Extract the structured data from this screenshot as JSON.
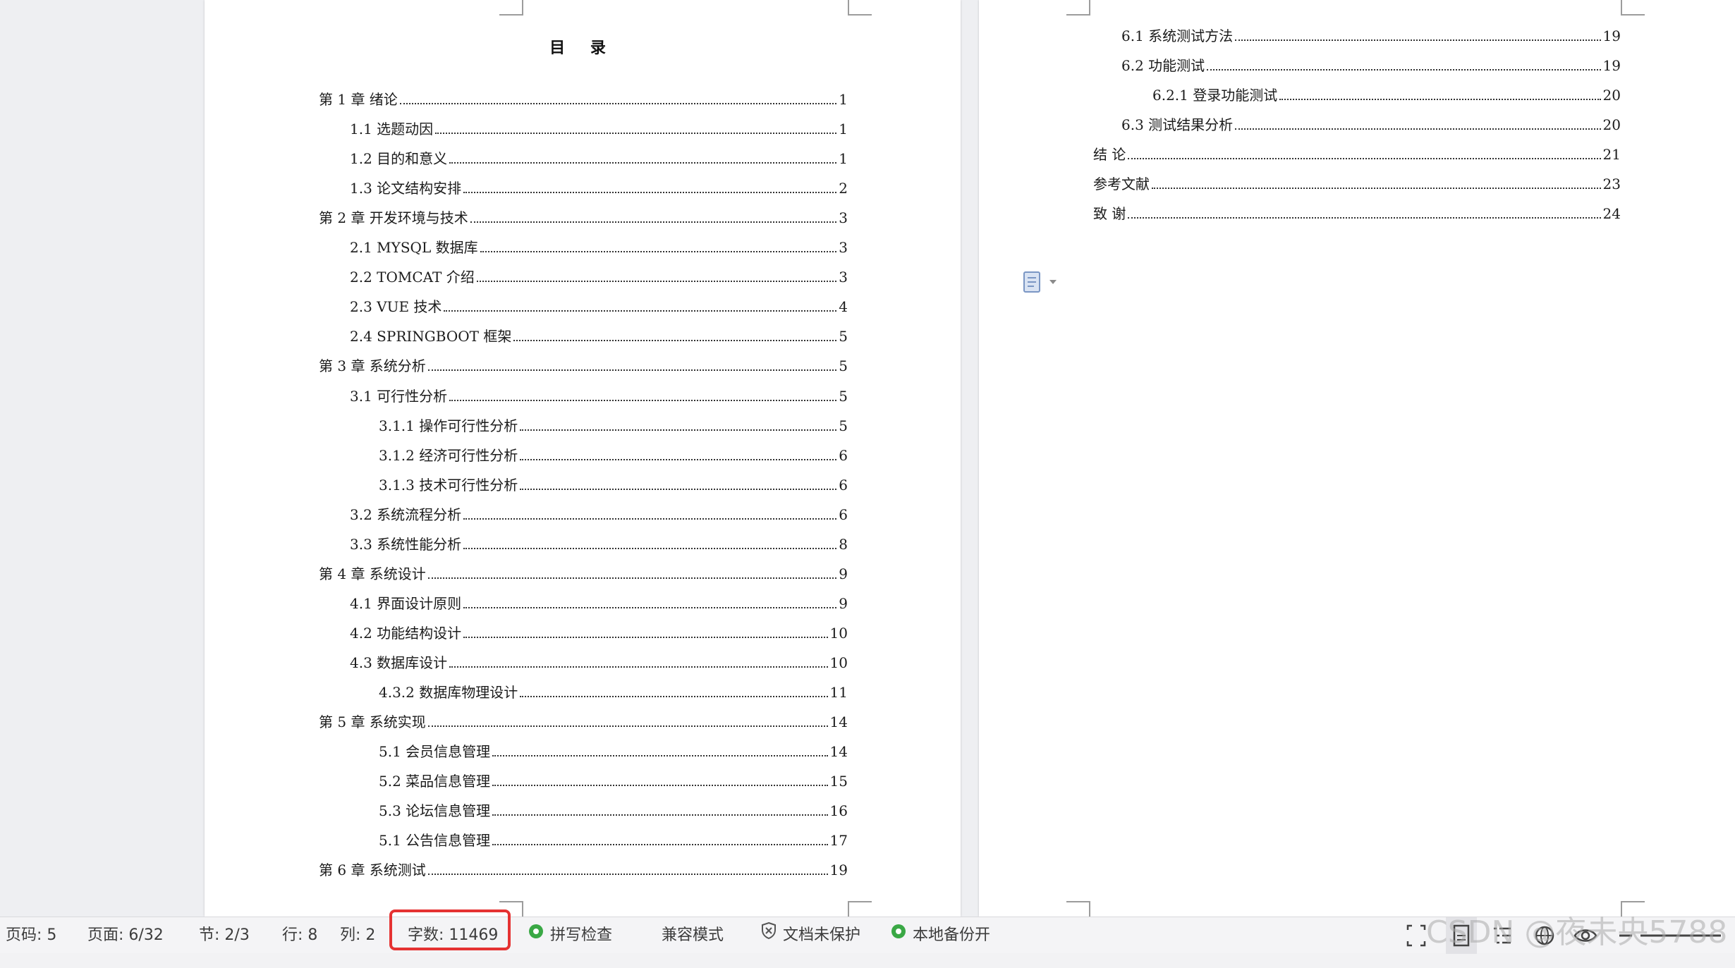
{
  "toc": {
    "title": "目 录",
    "left_page": [
      {
        "text": "第 1 章  绪论",
        "page": "1",
        "level": 1
      },
      {
        "text": "1.1 选题动因",
        "page": "1",
        "level": 2
      },
      {
        "text": "1.2 目的和意义",
        "page": "1",
        "level": 2
      },
      {
        "text": "1.3 论文结构安排",
        "page": "2",
        "level": 2
      },
      {
        "text": "第 2 章  开发环境与技术",
        "page": "3",
        "level": 1
      },
      {
        "text": "2.1 MYSQL 数据库",
        "page": "3",
        "level": 2
      },
      {
        "text": "2.2 TOMCAT 介绍",
        "page": "3",
        "level": 2
      },
      {
        "text": "2.3 VUE 技术",
        "page": "4",
        "level": 2
      },
      {
        "text": "2.4 SPRINGBOOT 框架",
        "page": "5",
        "level": 2
      },
      {
        "text": "第 3 章  系统分析",
        "page": "5",
        "level": 1
      },
      {
        "text": "3.1 可行性分析",
        "page": "5",
        "level": 2
      },
      {
        "text": "3.1.1 操作可行性分析",
        "page": "5",
        "level": 3
      },
      {
        "text": "3.1.2 经济可行性分析",
        "page": "6",
        "level": 3
      },
      {
        "text": "3.1.3 技术可行性分析",
        "page": "6",
        "level": 3
      },
      {
        "text": "3.2 系统流程分析",
        "page": "6",
        "level": 2
      },
      {
        "text": "3.3 系统性能分析",
        "page": "8",
        "level": 2
      },
      {
        "text": "第 4 章  系统设计",
        "page": "9",
        "level": 1
      },
      {
        "text": "4.1 界面设计原则",
        "page": "9",
        "level": 2
      },
      {
        "text": "4.2 功能结构设计",
        "page": "10",
        "level": 2
      },
      {
        "text": "4.3 数据库设计",
        "page": "10",
        "level": 2
      },
      {
        "text": "4.3.2  数据库物理设计",
        "page": "11",
        "level": 3
      },
      {
        "text": "第 5 章  系统实现",
        "page": "14",
        "level": 1
      },
      {
        "text": "5.1 会员信息管理",
        "page": "14",
        "level": 3
      },
      {
        "text": "5.2  菜品信息管理",
        "page": "15",
        "level": 3
      },
      {
        "text": "5.3 论坛信息管理",
        "page": "16",
        "level": 3
      },
      {
        "text": "5.1 公告信息管理",
        "page": "17",
        "level": 3
      },
      {
        "text": "第 6 章  系统测试",
        "page": "19",
        "level": 1
      }
    ],
    "right_page": [
      {
        "text": "6.1  系统测试方法",
        "page": "19",
        "level": 2
      },
      {
        "text": "6.2  功能测试",
        "page": "19",
        "level": 2
      },
      {
        "text": "6.2.1  登录功能测试",
        "page": "20",
        "level": 3
      },
      {
        "text": "6.3  测试结果分析",
        "page": "20",
        "level": 2
      },
      {
        "text": "结    论",
        "page": "21",
        "level": 1
      },
      {
        "text": "参考文献",
        "page": "23",
        "level": 1
      },
      {
        "text": "致    谢",
        "page": "24",
        "level": 1
      }
    ]
  },
  "statusbar": {
    "page_code": "页码: 5",
    "page_of": "页面: 6/32",
    "section": "节: 2/3",
    "row": "行: 8",
    "col": "列: 2",
    "word_count": "字数: 11469",
    "spell_check": "拼写检查",
    "compat_mode": "兼容模式",
    "doc_protect": "文档未保护",
    "local_backup": "本地备份开"
  },
  "watermark": "CSDN @夜未央5788",
  "colors": {
    "accent_green": "#3aa845",
    "highlight_red": "#e53232"
  }
}
